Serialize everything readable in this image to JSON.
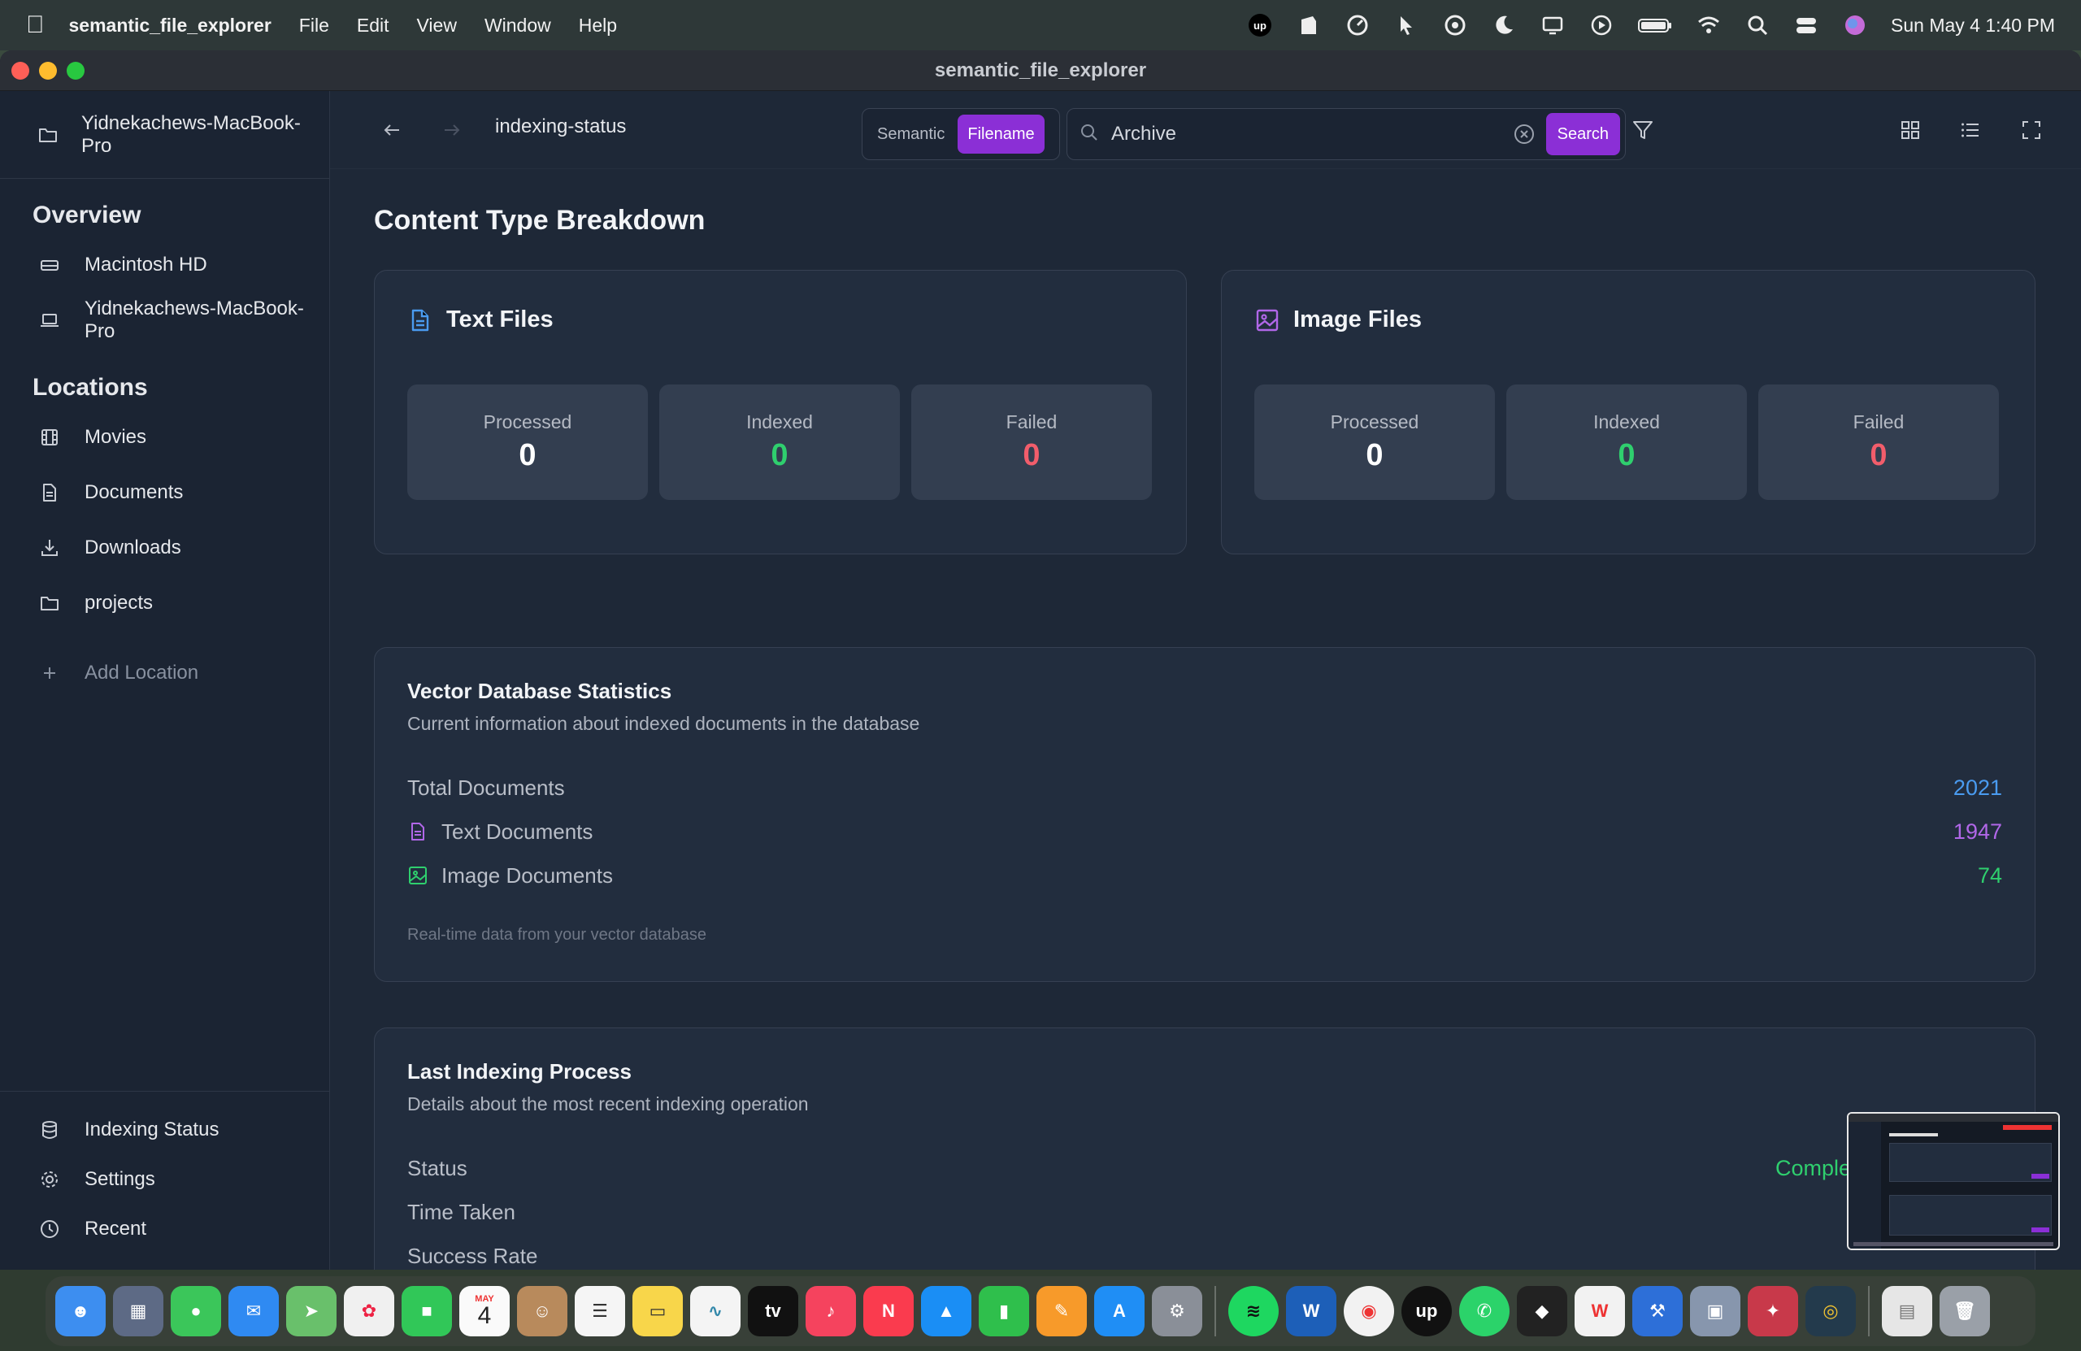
{
  "menubar": {
    "app_name": "semantic_file_explorer",
    "menus": [
      "File",
      "Edit",
      "View",
      "Window",
      "Help"
    ],
    "status_icons": [
      "upwork-icon",
      "notes-icon",
      "speed-icon",
      "cursor-icon",
      "gauge-icon",
      "moon-icon",
      "display-icon",
      "play-icon",
      "battery-icon",
      "wifi-icon",
      "search-icon",
      "control-center-icon",
      "siri-icon"
    ],
    "datetime": "Sun May 4  1:40 PM"
  },
  "window": {
    "title": "semantic_file_explorer"
  },
  "sidebar": {
    "device": "Yidnekachews-MacBook-Pro",
    "overview_title": "Overview",
    "overview_items": [
      {
        "label": "Macintosh HD",
        "icon": "drive-icon"
      },
      {
        "label": "Yidnekachews-MacBook-Pro",
        "icon": "laptop-icon"
      }
    ],
    "locations_title": "Locations",
    "location_items": [
      {
        "label": "Movies",
        "icon": "film-icon"
      },
      {
        "label": "Documents",
        "icon": "document-icon"
      },
      {
        "label": "Downloads",
        "icon": "download-icon"
      },
      {
        "label": "projects",
        "icon": "folder-icon"
      }
    ],
    "add_location": "Add Location",
    "bottom_items": [
      {
        "label": "Indexing Status",
        "icon": "database-icon"
      },
      {
        "label": "Settings",
        "icon": "gear-icon"
      },
      {
        "label": "Recent",
        "icon": "clock-icon"
      }
    ]
  },
  "topbar": {
    "breadcrumb": "indexing-status",
    "mode_semantic": "Semantic",
    "mode_filename": "Filename",
    "search_value": "Archive",
    "search_button": "Search"
  },
  "content": {
    "section_title": "Content Type Breakdown",
    "text_card": {
      "title": "Text Files",
      "processed_label": "Processed",
      "processed": "0",
      "indexed_label": "Indexed",
      "indexed": "0",
      "failed_label": "Failed",
      "failed": "0"
    },
    "image_card": {
      "title": "Image Files",
      "processed_label": "Processed",
      "processed": "0",
      "indexed_label": "Indexed",
      "indexed": "0",
      "failed_label": "Failed",
      "failed": "0"
    },
    "vector_db": {
      "title": "Vector Database Statistics",
      "subtitle": "Current information about indexed documents in the database",
      "total_label": "Total Documents",
      "total": "2021",
      "text_label": "Text Documents",
      "text": "1947",
      "image_label": "Image Documents",
      "image": "74",
      "footnote": "Real-time data from your vector database"
    },
    "last_indexing": {
      "title": "Last Indexing Process",
      "subtitle": "Details about the most recent indexing operation",
      "status_label": "Status",
      "status_value": "Comple",
      "time_label": "Time Taken",
      "success_label": "Success Rate"
    }
  },
  "colors": {
    "accent": "#8b2fd6",
    "blue": "#4a9bf0",
    "purple": "#b167e8",
    "green": "#2fcf6e",
    "red": "#f25d6b"
  },
  "dock": {
    "apps": [
      "Finder",
      "Launchpad",
      "Messages",
      "Mail",
      "Maps",
      "Photos",
      "FaceTime",
      "Calendar",
      "Contacts",
      "Reminders",
      "Notes",
      "Freeform",
      "TV",
      "Music",
      "News",
      "Keynote",
      "Numbers",
      "Pages",
      "App Store",
      "System Settings",
      "Spotify",
      "Word",
      "Chrome",
      "Upwork",
      "WhatsApp",
      "Box",
      "Wave",
      "Xcode",
      "Preview",
      "Photo Booth",
      "Copilot",
      "Files",
      "Trash"
    ],
    "calendar_month": "MAY",
    "calendar_day": "4"
  }
}
